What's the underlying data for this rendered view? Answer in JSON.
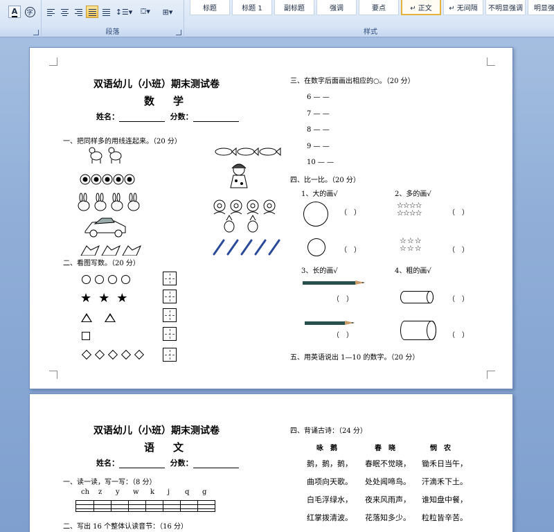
{
  "ribbon": {
    "paragraph_group_label": "段落",
    "styles_group_label": "样式",
    "font_color_glyph": "A",
    "char_border_glyph": "字",
    "styles": [
      {
        "label": "标题",
        "selected": false
      },
      {
        "label": "标题 1",
        "selected": false
      },
      {
        "label": "副标题",
        "selected": false
      },
      {
        "label": "强调",
        "selected": false
      },
      {
        "label": "要点",
        "selected": false
      },
      {
        "label": "↵ 正文",
        "selected": true
      },
      {
        "label": "↵ 无间隔",
        "selected": false
      },
      {
        "label": "不明显强调",
        "selected": false
      },
      {
        "label": "明显强调",
        "selected": false
      }
    ]
  },
  "page1": {
    "title": "双语幼儿（小班）期末测试卷",
    "subject": "数　学",
    "name_label": "姓名：",
    "score_label": "分数：",
    "section1": "一、把同样多的用线连起来。（20 分）",
    "section2": "二、看图写数。（20 分）",
    "section3": "三、在数字后面画出相应的○。（20 分）",
    "section3_numbers": [
      "6 — —",
      "7 — —",
      "8 — —",
      "9 — —",
      "10 — —"
    ],
    "section4": "四、比一比。（20 分）",
    "compare": {
      "q1": "1、大的画√",
      "q2": "2、多的画√",
      "q3": "3、长的画√",
      "q4": "4、粗的画√",
      "paren": "（　）"
    },
    "section5": "五、用英语说出 1—10 的数字。（20 分）"
  },
  "page2": {
    "title": "双语幼儿（小班）期末测试卷",
    "subject": "语　文",
    "name_label": "姓名：",
    "score_label": "分数：",
    "section1": "一、读一读，写一写：（8 分）",
    "pinyin": [
      "ch",
      "z",
      "y",
      "w",
      "k",
      "j",
      "q",
      "g"
    ],
    "section2": "二、写出 16 个整体认读音节：（16 分）",
    "section4": "四、背诵古诗：（24 分）",
    "poems": [
      {
        "title": "咏　鹅",
        "lines": [
          "鹅，鹅，鹅，",
          "曲项向天歌。",
          "白毛浮绿水，",
          "红掌拨清波。"
        ]
      },
      {
        "title": "春　晓",
        "lines": [
          "春眠不觉晓，",
          "处处闻啼鸟。",
          "夜来风雨声，",
          "花落知多少。"
        ]
      },
      {
        "title": "悯　农",
        "lines": [
          "锄禾日当午，",
          "汗滴禾下土。",
          "谁知盘中餐，",
          "粒粒皆辛苦。"
        ]
      }
    ]
  }
}
